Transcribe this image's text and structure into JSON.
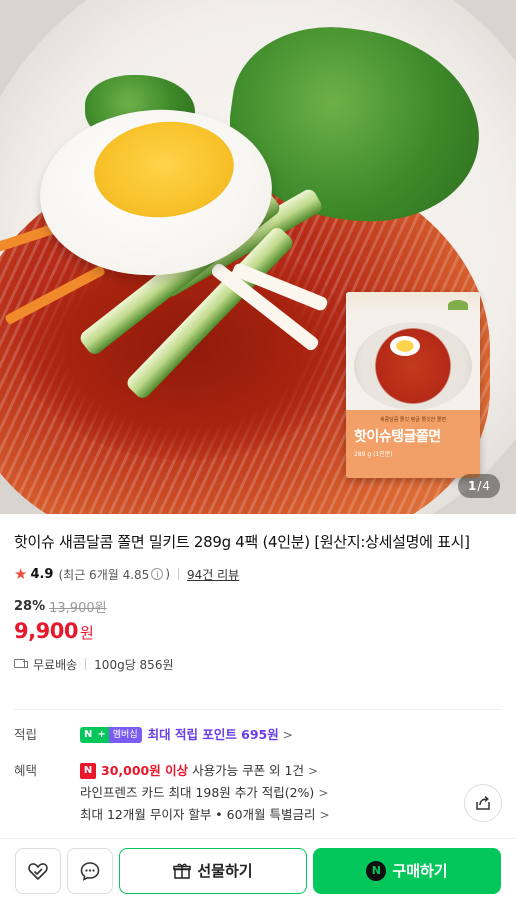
{
  "gallery": {
    "current": "1",
    "separator": "/",
    "total": "4",
    "package_subtitle": "새콤달콤 쫄깃 탱글 쫄깃한 쫄면",
    "package_name": "핫이슈탱글쫄면",
    "package_weight": "289 g (1인분)"
  },
  "product": {
    "title": "핫이슈 새콤달콤 쫄면 밀키트 289g 4팩 (4인분) [원산지:상세설명에 표시]",
    "rating": "4.9",
    "recent_rating": "(최근 6개월 4.85",
    "recent_close": ")",
    "info_glyph": "i",
    "reviews": "94건 리뷰",
    "discount_rate": "28%",
    "original_price": "13,900원",
    "price": "9,900",
    "price_unit": "원",
    "shipping": "무료배송",
    "unit_price": "100g당 856원"
  },
  "benefits": {
    "points_label": "적립",
    "badge_n": "N",
    "badge_plus": "+",
    "badge_member": "멤버십",
    "points_text": "최대 적립 포인트 695원",
    "benefit_label": "혜택",
    "coupon_badge": "N",
    "coupon_amount": "30,000원 이상",
    "coupon_text": "사용가능 쿠폰 외 1건",
    "card_text": "라인프렌즈 카드 최대 198원 추가 적립(2%)",
    "installment_text": "최대 12개월 무이자 할부 • 60개월 특별금리",
    "chevron": ">"
  },
  "actions": {
    "gift_label": "선물하기",
    "buy_label": "구매하기",
    "buy_badge": "N"
  },
  "colors": {
    "price_red": "#e8172b",
    "naver_green": "#03c75a",
    "membership_purple": "#7b5cf0",
    "point_purple": "#6a3ee6",
    "star_red": "#f24b3f"
  },
  "icons": [
    "star-icon",
    "info-icon",
    "truck-icon",
    "share-icon",
    "heart-check-icon",
    "chat-icon",
    "gift-icon"
  ]
}
